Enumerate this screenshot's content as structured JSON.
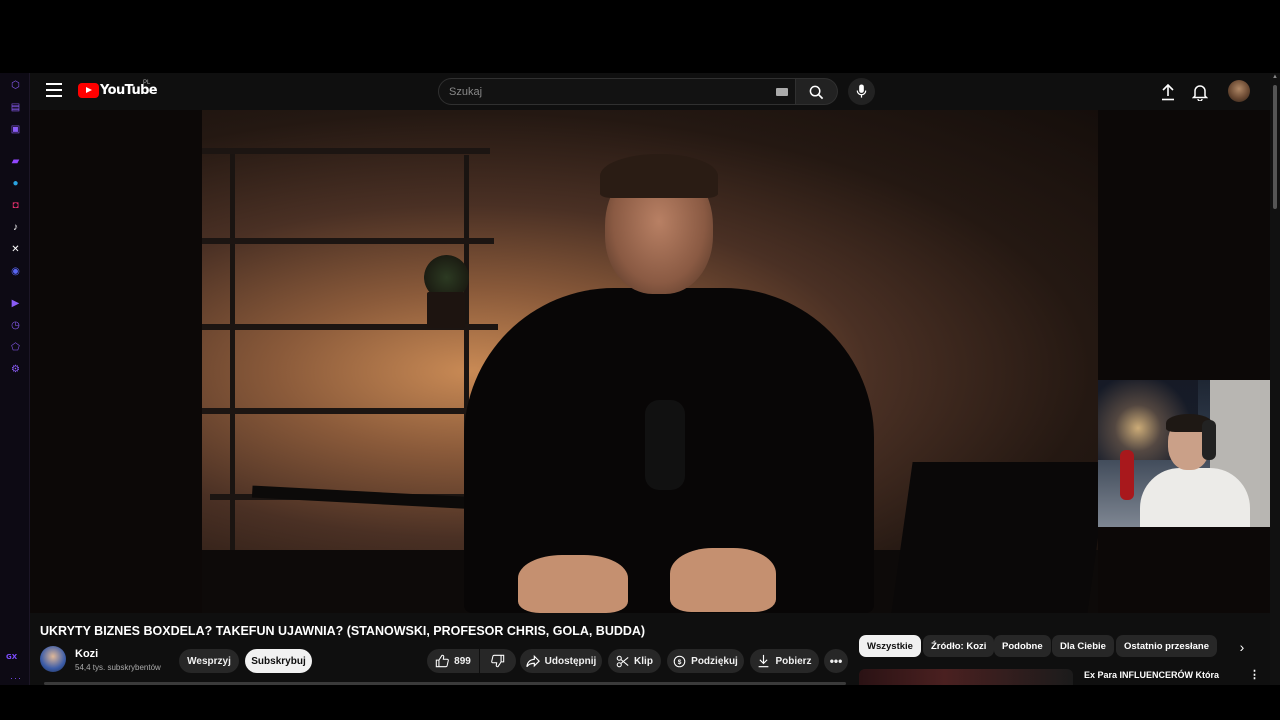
{
  "header": {
    "logo_text": "YouTube",
    "region": "PL",
    "search_placeholder": "Szukaj"
  },
  "video": {
    "title": "UKRYTY BIZNES BOXDELA? TAKEFUN UJAWNIA? (STANOWSKI, PROFESOR CHRIS, GOLA, BUDDA)"
  },
  "channel": {
    "name": "Kozi",
    "subscribers": "54,4 tys. subskrybentów",
    "support_label": "Wesprzyj",
    "subscribe_label": "Subskrybuj"
  },
  "actions": {
    "likes": "899",
    "share_label": "Udostępnij",
    "clip_label": "Klip",
    "thanks_label": "Podziękuj",
    "download_label": "Pobierz"
  },
  "chips": [
    {
      "label": "Wszystkie",
      "active": true
    },
    {
      "label": "Źródło: Kozi",
      "active": false
    },
    {
      "label": "Podobne",
      "active": false
    },
    {
      "label": "Dla Ciebie",
      "active": false
    },
    {
      "label": "Ostatnio przesłane",
      "active": false
    }
  ],
  "recommendation": {
    "title": "Ex Para INFLUENCERÓW Która"
  },
  "gx_sidebar": {
    "label": "GX",
    "icons": [
      "cube-icon",
      "wallet-icon",
      "messenger-icon",
      "twitch-icon",
      "telegram-icon",
      "instagram-icon",
      "tiktok-icon",
      "x-icon",
      "discord-icon",
      "player-icon",
      "history-icon",
      "pinboard-icon",
      "settings-icon"
    ]
  },
  "colors": {
    "youtube_red": "#ff0000",
    "background": "#0f0f0f",
    "gx_accent": "#7c4dff"
  }
}
